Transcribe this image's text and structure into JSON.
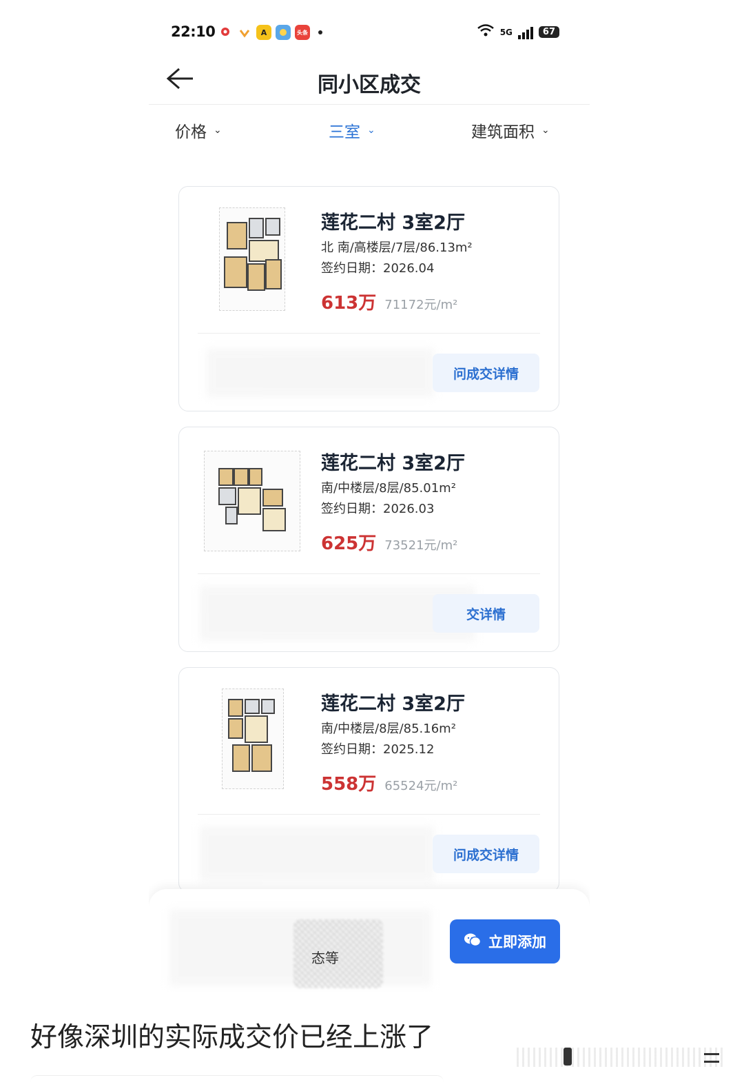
{
  "status_bar": {
    "time": "22:10",
    "network": "5G",
    "battery": "67"
  },
  "nav": {
    "title": "同小区成交"
  },
  "filters": {
    "price": "价格",
    "rooms": "三室",
    "area": "建筑面积"
  },
  "listings": [
    {
      "title": "莲花二村 3室2厅",
      "info": "北 南/高楼层/7层/86.13m²",
      "date": "签约日期：2026.04",
      "price": "613万",
      "unit_price": "71172元/m²",
      "button": "问成交详情"
    },
    {
      "title": "莲花二村 3室2厅",
      "info": "南/中楼层/8层/85.01m²",
      "date": "签约日期：2026.03",
      "price": "625万",
      "unit_price": "73521元/m²",
      "button": "交详情"
    },
    {
      "title": "莲花二村 3室2厅",
      "info": "南/中楼层/8层/85.16m²",
      "date": "签约日期：2025.12",
      "price": "558万",
      "unit_price": "65524元/m²",
      "button": "问成交详情"
    }
  ],
  "bottom_bar": {
    "partial_text": "态等",
    "add_button": "立即添加"
  },
  "caption": "好像深圳的实际成交价已经上涨了",
  "colors": {
    "accent_blue": "#2b73d6",
    "price_red": "#cc3333",
    "button_blue": "#2a6ee8"
  }
}
